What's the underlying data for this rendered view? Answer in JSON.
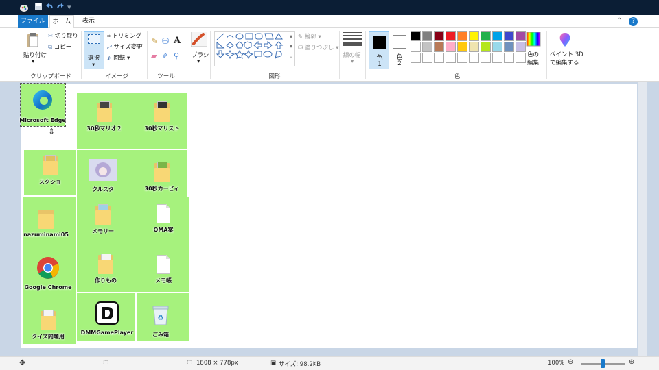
{
  "tabs": {
    "file": "ファイル",
    "home": "ホーム",
    "view": "表示"
  },
  "ribbon": {
    "clipboard": {
      "paste": "貼り付け",
      "cut": "切り取り",
      "copy": "コピー",
      "group": "クリップボード"
    },
    "image": {
      "select": "選択",
      "crop": "トリミング",
      "resize": "サイズ変更",
      "rotate": "回転",
      "group": "イメージ"
    },
    "tools": {
      "group": "ツール"
    },
    "brushes": {
      "label": "ブラシ"
    },
    "shapes": {
      "outline": "輪郭",
      "fill": "塗りつぶし",
      "group": "図形"
    },
    "size": {
      "label": "線の幅"
    },
    "colors": {
      "color1": "色",
      "color1_num": "1",
      "color2": "色",
      "color2_num": "2",
      "edit_line1": "色の",
      "edit_line2": "編集",
      "group": "色",
      "primary": "#000000",
      "secondary": "#ffffff",
      "palette": [
        "#000000",
        "#7f7f7f",
        "#880015",
        "#ed1c24",
        "#ff7f27",
        "#fff200",
        "#22b14c",
        "#00a2e8",
        "#3f48cc",
        "#a349a4",
        "#ffffff",
        "#c3c3c3",
        "#b97a57",
        "#ffaec9",
        "#ffc90e",
        "#efe4b0",
        "#b5e61d",
        "#99d9ea",
        "#7092be",
        "#c8bfe7",
        "#ffffff",
        "#ffffff",
        "#ffffff",
        "#ffffff",
        "#ffffff",
        "#ffffff",
        "#ffffff",
        "#ffffff",
        "#ffffff",
        "#ffffff"
      ]
    },
    "paint3d": {
      "line1": "ペイント 3D",
      "line2": "で編集する"
    }
  },
  "desktop_icons": [
    {
      "label": "Microsoft Edge",
      "kind": "edge-icon"
    },
    {
      "label": "30秒マリオ２",
      "kind": "folder-icon"
    },
    {
      "label": "30秒マリスト",
      "kind": "folder-icon"
    },
    {
      "label": "スクショ",
      "kind": "folder-icon"
    },
    {
      "label": "クルスタ",
      "kind": "app-icon"
    },
    {
      "label": "30秒カービィ",
      "kind": "folder-icon"
    },
    {
      "label": "nazuminami05",
      "kind": "folder-icon"
    },
    {
      "label": "メモリー",
      "kind": "folder-icon"
    },
    {
      "label": "QMA案",
      "kind": "document-icon"
    },
    {
      "label": "Google Chrome",
      "kind": "chrome-icon"
    },
    {
      "label": "作りもの",
      "kind": "folder-icon"
    },
    {
      "label": "メモ帳",
      "kind": "document-icon"
    },
    {
      "label": "クイズ問題用",
      "kind": "folder-icon"
    },
    {
      "label": "DMMGamePlayer",
      "kind": "dmm-icon"
    },
    {
      "label": "ごみ箱",
      "kind": "recycle-bin-icon"
    }
  ],
  "status": {
    "dimensions": "1808 × 778px",
    "file_size": "サイズ: 98.2KB",
    "zoom": "100%",
    "zoom_level_percent": 100
  }
}
